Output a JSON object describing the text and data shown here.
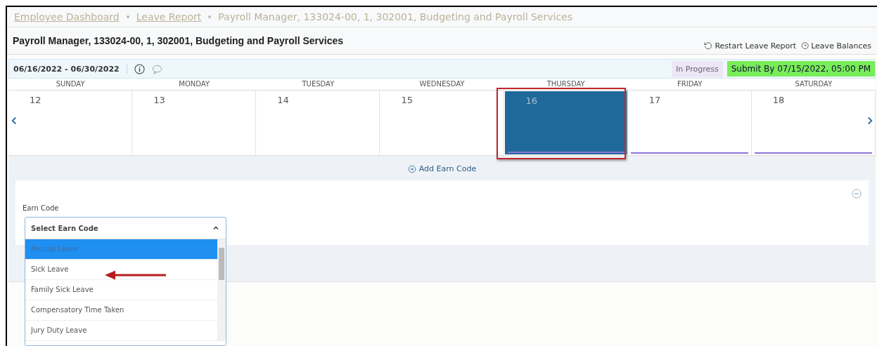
{
  "breadcrumb": [
    {
      "label": "Employee Dashboard",
      "link": true
    },
    {
      "label": "Leave Report",
      "link": true
    },
    {
      "label": "Payroll Manager, 133024-00, 1, 302001, Budgeting and Payroll Services",
      "link": false
    }
  ],
  "page_title": "Payroll Manager, 133024-00, 1, 302001, Budgeting and Payroll Services",
  "actions": [
    {
      "label": "Restart Leave Report",
      "kind": "restart"
    },
    {
      "label": "Leave Balances",
      "kind": "balances"
    }
  ],
  "period": "06/16/2022 - 06/30/2022",
  "status": "In Progress",
  "deadline": "Submit By 07/15/2022, 05:00 PM",
  "days": [
    {
      "weekday": "SUNDAY",
      "date": "12",
      "selected": false,
      "underline": false
    },
    {
      "weekday": "MONDAY",
      "date": "13",
      "selected": false,
      "underline": false
    },
    {
      "weekday": "TUESDAY",
      "date": "14",
      "selected": false,
      "underline": false
    },
    {
      "weekday": "WEDNESDAY",
      "date": "15",
      "selected": false,
      "underline": false
    },
    {
      "weekday": "THURSDAY",
      "date": "16",
      "selected": true,
      "underline": true
    },
    {
      "weekday": "FRIDAY",
      "date": "17",
      "selected": false,
      "underline": true
    },
    {
      "weekday": "SATURDAY",
      "date": "18",
      "selected": false,
      "underline": true
    }
  ],
  "add_earn_code": "Add Earn Code",
  "earn_code": {
    "label": "Earn Code",
    "placeholder": "Select Earn Code",
    "expanded": true,
    "options": [
      {
        "label": "Annual Leave",
        "selected": true
      },
      {
        "label": "Sick Leave",
        "selected": false
      },
      {
        "label": "Family Sick Leave",
        "selected": false
      },
      {
        "label": "Compensatory Time Taken",
        "selected": false
      },
      {
        "label": "Jury Duty Leave",
        "selected": false
      }
    ]
  }
}
